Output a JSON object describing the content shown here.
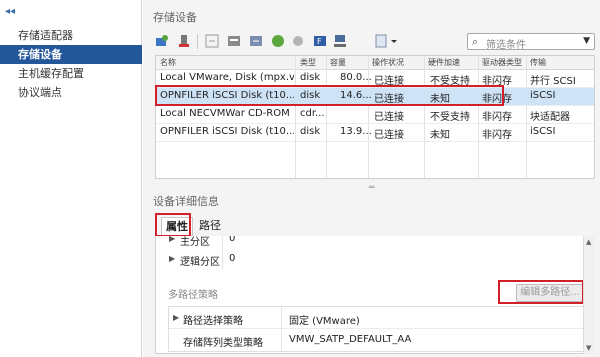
{
  "nav": {
    "collapse_glyph": "◂◂",
    "items": [
      {
        "label": "存储适配器",
        "active": false
      },
      {
        "label": "存储设备",
        "active": true
      },
      {
        "label": "主机缓存配置",
        "active": false
      },
      {
        "label": "协议端点",
        "active": false
      }
    ]
  },
  "storage": {
    "section_title": "存储设备",
    "filter": {
      "icon": "search-icon",
      "placeholder": "筛选条件"
    },
    "columns": [
      "名称",
      "类型",
      "容量",
      "操作状况",
      "硬件加速",
      "驱动器类型",
      "传输"
    ],
    "rows": [
      {
        "name": "Local VMware, Disk (mpx.v...",
        "type": "disk",
        "capacity": "80.0...",
        "status": "已连接",
        "hw_accel": "不受支持",
        "drive_type": "非闪存",
        "transport": "并行 SCSI",
        "selected": false
      },
      {
        "name": "OPNFILER iSCSI Disk (t10....",
        "type": "disk",
        "capacity": "14.6...",
        "status": "已连接",
        "hw_accel": "未知",
        "drive_type": "非闪存",
        "transport": "iSCSI",
        "selected": true
      },
      {
        "name": "Local NECVMWar CD-ROM ...",
        "type": "cdr...",
        "capacity": "",
        "status": "已连接",
        "hw_accel": "不受支持",
        "drive_type": "非闪存",
        "transport": "块适配器",
        "selected": false
      },
      {
        "name": "OPNFILER iSCSI Disk (t10....",
        "type": "disk",
        "capacity": "13.9...",
        "status": "已连接",
        "hw_accel": "未知",
        "drive_type": "非闪存",
        "transport": "iSCSI",
        "selected": false
      }
    ],
    "splitter_glyph": "═"
  },
  "details": {
    "section_title": "设备详细信息",
    "tabs": [
      {
        "label": "属性",
        "active": true
      },
      {
        "label": "路径",
        "active": false
      }
    ],
    "properties": [
      {
        "key": "主分区",
        "value": "0"
      },
      {
        "key": "逻辑分区",
        "value": "0"
      }
    ],
    "multipath": {
      "label": "多路径策略",
      "edit_button": "编辑多路径...",
      "rows": [
        {
          "key": "路径选择策略",
          "value": "固定 (VMware)",
          "expandable": true
        },
        {
          "key": "存储阵列类型策略",
          "value": "VMW_SATP_DEFAULT_AA",
          "expandable": false
        }
      ]
    }
  },
  "colors": {
    "nav_active": "#24579a",
    "row_selected": "#cfe3f7",
    "highlight": "#d1202a"
  }
}
